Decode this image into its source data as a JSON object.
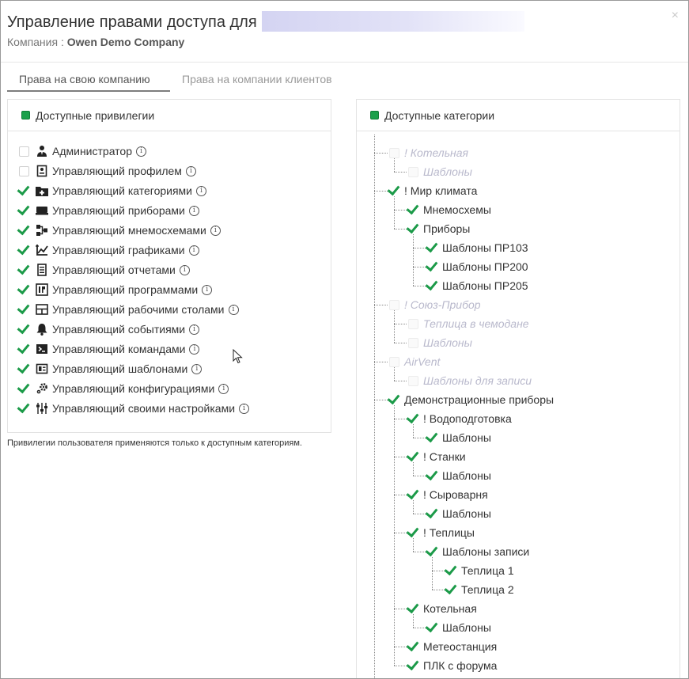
{
  "dialog": {
    "title": "Управление правами доступа для",
    "company_label": "Компания :",
    "company_name": "Owen Demo Company",
    "close_icon": "×"
  },
  "tabs": [
    {
      "label": "Права на свою компанию",
      "active": true
    },
    {
      "label": "Права на компании клиентов",
      "active": false
    }
  ],
  "privileges": {
    "title": "Доступные привилегии",
    "items": [
      {
        "label": "Администратор",
        "checked": false,
        "icon": "admin-icon"
      },
      {
        "label": "Управляющий профилем",
        "checked": false,
        "icon": "profile-icon"
      },
      {
        "label": "Управляющий категориями",
        "checked": true,
        "icon": "folder-plus-icon"
      },
      {
        "label": "Управляющий приборами",
        "checked": true,
        "icon": "device-icon"
      },
      {
        "label": "Управляющий мнемосхемами",
        "checked": true,
        "icon": "mnemoscheme-icon"
      },
      {
        "label": "Управляющий графиками",
        "checked": true,
        "icon": "chart-icon"
      },
      {
        "label": "Управляющий отчетами",
        "checked": true,
        "icon": "report-icon"
      },
      {
        "label": "Управляющий программами",
        "checked": true,
        "icon": "program-icon"
      },
      {
        "label": "Управляющий рабочими столами",
        "checked": true,
        "icon": "desktop-icon"
      },
      {
        "label": "Управляющий событиями",
        "checked": true,
        "icon": "bell-icon"
      },
      {
        "label": "Управляющий командами",
        "checked": true,
        "icon": "terminal-icon"
      },
      {
        "label": "Управляющий шаблонами",
        "checked": true,
        "icon": "template-icon"
      },
      {
        "label": "Управляющий конфигурациями",
        "checked": true,
        "icon": "gears-icon"
      },
      {
        "label": "Управляющий своими настройками",
        "checked": true,
        "icon": "sliders-icon"
      }
    ],
    "note": "Привилегии пользователя применяются только к доступным категориям."
  },
  "categories": {
    "title": "Доступные категории",
    "items": [
      {
        "label": "! Котельная",
        "level": 0,
        "checked": false,
        "disabled": true
      },
      {
        "label": "Шаблоны",
        "level": 1,
        "checked": false,
        "disabled": true
      },
      {
        "label": "! Мир климата",
        "level": 0,
        "checked": true,
        "disabled": false
      },
      {
        "label": "Мнемосхемы",
        "level": 1,
        "checked": true,
        "disabled": false
      },
      {
        "label": "Приборы",
        "level": 1,
        "checked": true,
        "disabled": false
      },
      {
        "label": "Шаблоны ПР103",
        "level": 2,
        "checked": true,
        "disabled": false
      },
      {
        "label": "Шаблоны ПР200",
        "level": 2,
        "checked": true,
        "disabled": false
      },
      {
        "label": "Шаблоны ПР205",
        "level": 2,
        "checked": true,
        "disabled": false
      },
      {
        "label": "! Союз-Прибор",
        "level": 0,
        "checked": false,
        "disabled": true
      },
      {
        "label": "Теплица в чемодане",
        "level": 1,
        "checked": false,
        "disabled": true
      },
      {
        "label": "Шаблоны",
        "level": 1,
        "checked": false,
        "disabled": true
      },
      {
        "label": "AirVent",
        "level": 0,
        "checked": false,
        "disabled": true
      },
      {
        "label": "Шаблоны для записи",
        "level": 1,
        "checked": false,
        "disabled": true
      },
      {
        "label": "Демонстрационные приборы",
        "level": 0,
        "checked": true,
        "disabled": false
      },
      {
        "label": "! Водоподготовка",
        "level": 1,
        "checked": true,
        "disabled": false
      },
      {
        "label": "Шаблоны",
        "level": 2,
        "checked": true,
        "disabled": false
      },
      {
        "label": "! Станки",
        "level": 1,
        "checked": true,
        "disabled": false
      },
      {
        "label": "Шаблоны",
        "level": 2,
        "checked": true,
        "disabled": false
      },
      {
        "label": "! Сыроварня",
        "level": 1,
        "checked": true,
        "disabled": false
      },
      {
        "label": "Шаблоны",
        "level": 2,
        "checked": true,
        "disabled": false
      },
      {
        "label": "! Теплицы",
        "level": 1,
        "checked": true,
        "disabled": false
      },
      {
        "label": "Шаблоны записи",
        "level": 2,
        "checked": true,
        "disabled": false
      },
      {
        "label": "Теплица 1",
        "level": 3,
        "checked": true,
        "disabled": false
      },
      {
        "label": "Теплица 2",
        "level": 3,
        "checked": true,
        "disabled": false
      },
      {
        "label": "Котельная",
        "level": 1,
        "checked": true,
        "disabled": false
      },
      {
        "label": "Шаблоны",
        "level": 2,
        "checked": true,
        "disabled": false
      },
      {
        "label": "Метеостанция",
        "level": 1,
        "checked": true,
        "disabled": false
      },
      {
        "label": "ПЛК с форума",
        "level": 1,
        "checked": true,
        "disabled": false
      }
    ]
  },
  "colors": {
    "accent": "#1b9a48",
    "disabled_text": "#b9b9cc"
  }
}
